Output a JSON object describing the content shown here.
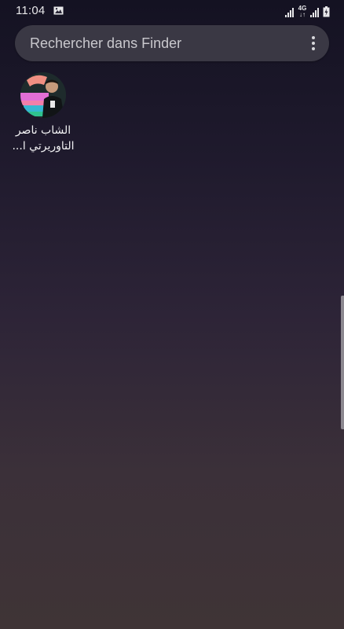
{
  "status_bar": {
    "time": "11:04",
    "network_type": "4G",
    "network_arrows": "↓↑",
    "icons": [
      "gallery-icon",
      "signal-icon",
      "signal-icon",
      "battery-charging-icon"
    ]
  },
  "search": {
    "placeholder": "Rechercher dans Finder",
    "more_icon": "more-vert-icon"
  },
  "apps": [
    {
      "label_line1": "الشاب ناصر",
      "label_line2": "التاوريرتي ا..."
    }
  ],
  "colors": {
    "background_top": "#141222",
    "background_bottom": "#3f3436",
    "search_bar": "#3a3844"
  }
}
